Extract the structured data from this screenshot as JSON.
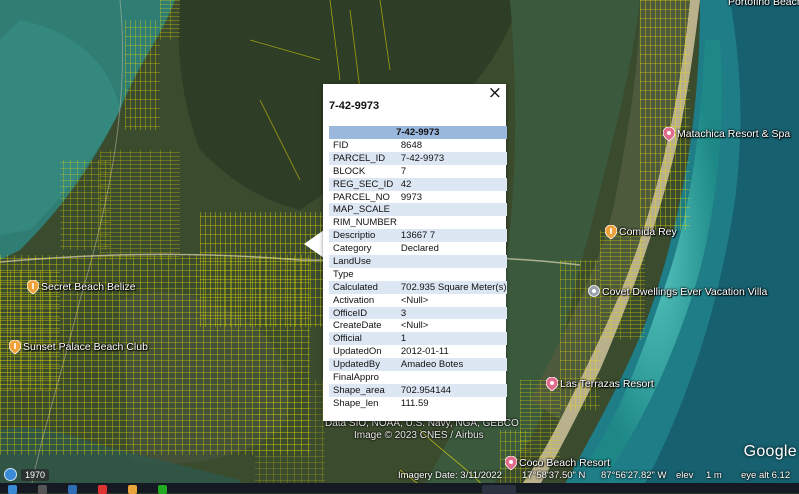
{
  "window": {
    "partial_top_right_label": "Portofino Beach"
  },
  "places": [
    {
      "name": "Matachica Resort & Spa",
      "icon": "hotel-pin-icon",
      "color": "#e06b8b"
    },
    {
      "name": "Comida Rey",
      "icon": "restaurant-pin-icon",
      "color": "#f0a23a"
    },
    {
      "name": "Covet Dwellings Ever Vacation Villa",
      "icon": "lodging-pin-icon",
      "color": "#9aa3ad"
    },
    {
      "name": "Secret Beach Belize",
      "icon": "restaurant-pin-icon",
      "color": "#f0a23a"
    },
    {
      "name": "Sunset Palace Beach Club",
      "icon": "restaurant-pin-icon",
      "color": "#f0a23a"
    },
    {
      "name": "Las Terrazas Resort",
      "icon": "hotel-pin-icon",
      "color": "#e06b8b"
    },
    {
      "name": "Coco Beach Resort",
      "icon": "hotel-pin-icon",
      "color": "#e06b8b"
    }
  ],
  "popup": {
    "title": "7-42-9973",
    "table_header": "7-42-9973",
    "close_label": "×",
    "rows": [
      {
        "key": "FID",
        "value": "8648"
      },
      {
        "key": "PARCEL_ID",
        "value": "7-42-9973"
      },
      {
        "key": "BLOCK",
        "value": "7"
      },
      {
        "key": "REG_SEC_ID",
        "value": "42"
      },
      {
        "key": "PARCEL_NO",
        "value": "9973"
      },
      {
        "key": "MAP_SCALE",
        "value": ""
      },
      {
        "key": "RIM_NUMBER",
        "value": ""
      },
      {
        "key": "Descriptio",
        "value": "13667 7"
      },
      {
        "key": "Category",
        "value": "Declared"
      },
      {
        "key": "LandUse",
        "value": ""
      },
      {
        "key": "Type",
        "value": ""
      },
      {
        "key": "Calculated",
        "value": "702.935 Square Meter(s)"
      },
      {
        "key": "Activation",
        "value": "<Null>"
      },
      {
        "key": "OfficeID",
        "value": "3"
      },
      {
        "key": "CreateDate",
        "value": "<Null>"
      },
      {
        "key": "Official",
        "value": "1"
      },
      {
        "key": "UpdatedOn",
        "value": "2012-01-11"
      },
      {
        "key": "UpdatedBy",
        "value": "Amadeo Botes"
      },
      {
        "key": "FinalAppro",
        "value": ""
      },
      {
        "key": "Shape_area",
        "value": "702.954144"
      },
      {
        "key": "Shape_len",
        "value": "111.59"
      }
    ]
  },
  "credits": {
    "line1": "Data SIO, NOAA, U.S. Navy, NGA, GEBCO",
    "line2": "Image © 2023 CNES / Airbus",
    "logo": "Google"
  },
  "status_bar": {
    "history_year": "1970",
    "imagery_date": "Imagery Date: 3/11/2022",
    "latitude": "17°58'37.50\" N",
    "longitude": "87°56'27.82\" W",
    "elev_label": "elev",
    "elev_value": "1 m",
    "eye_alt": "eye alt  6.12"
  },
  "colors": {
    "parcel_lines": "#f2e600",
    "popup_header": "#9ab7dc",
    "popup_alt_row": "#dce7f3",
    "sea": "#1f8c8c",
    "land": "#3c4a2c"
  }
}
